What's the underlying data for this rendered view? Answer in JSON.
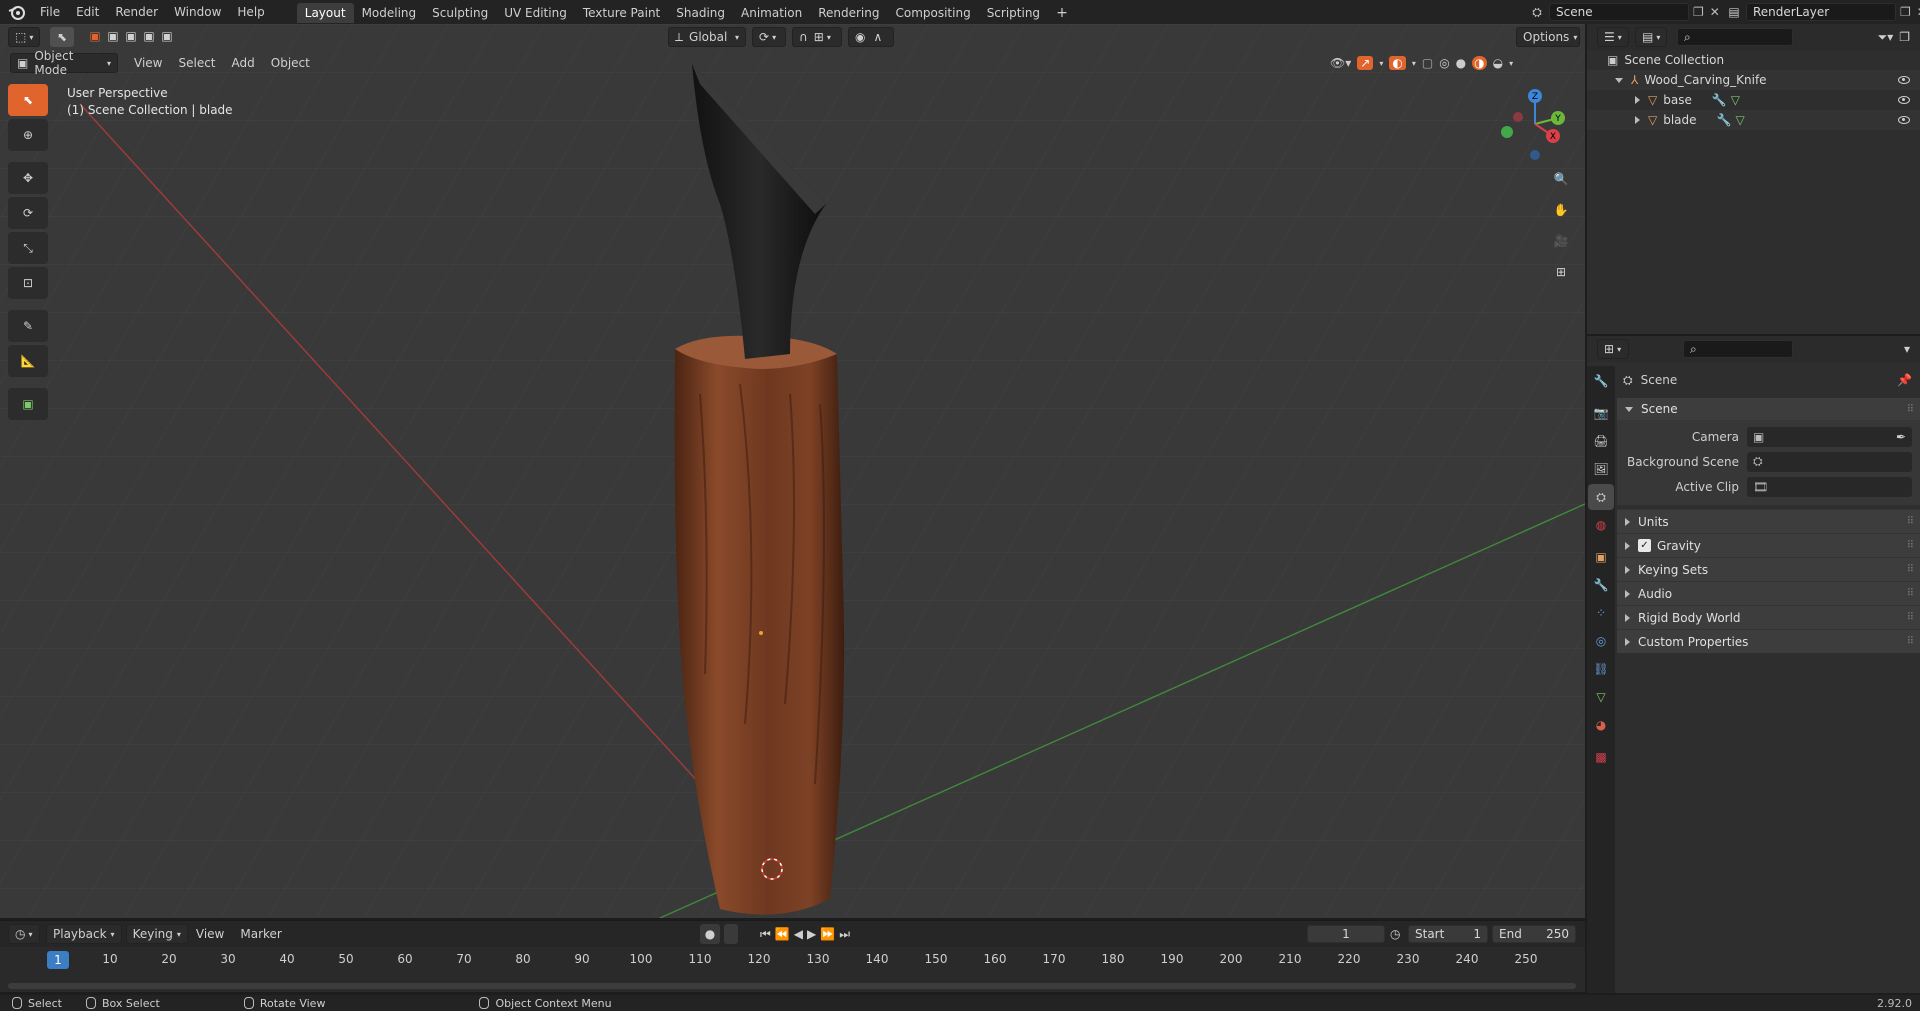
{
  "topbar": {
    "menus": [
      "File",
      "Edit",
      "Render",
      "Window",
      "Help"
    ],
    "workspaces": [
      "Layout",
      "Modeling",
      "Sculpting",
      "UV Editing",
      "Texture Paint",
      "Shading",
      "Animation",
      "Rendering",
      "Compositing",
      "Scripting"
    ],
    "active_workspace": "Layout",
    "add_tab_label": "+",
    "scene_name": "Scene",
    "view_layer": "RenderLayer"
  },
  "viewport": {
    "mode": "Object Mode",
    "menus": [
      "View",
      "Select",
      "Add",
      "Object"
    ],
    "transform_orientation": "Global",
    "options_label": "Options",
    "perspective_label": "User Perspective",
    "collection_label": "(1) Scene Collection | blade",
    "tools": [
      "select-box-icon",
      "cursor-icon",
      "move-icon",
      "rotate-icon",
      "scale-icon",
      "transform-icon",
      "annotate-icon",
      "measure-icon",
      "add-cube-icon"
    ],
    "gizmo_axes": [
      "X",
      "Y",
      "Z"
    ]
  },
  "timeline": {
    "menus": [
      "Playback",
      "Keying",
      "View",
      "Marker"
    ],
    "current_frame": "1",
    "start_label": "Start",
    "start_value": "1",
    "end_label": "End",
    "end_value": "250",
    "ruler_ticks": [
      "10",
      "20",
      "30",
      "40",
      "50",
      "60",
      "70",
      "80",
      "90",
      "100",
      "110",
      "120",
      "130",
      "140",
      "150",
      "160",
      "170",
      "180",
      "190",
      "200",
      "210",
      "220",
      "230",
      "240",
      "250"
    ],
    "frame_marker": "1"
  },
  "statusbar": {
    "items": [
      "Select",
      "Box Select",
      "Rotate View",
      "Object Context Menu"
    ],
    "version": "2.92.0"
  },
  "outliner": {
    "root": "Scene Collection",
    "collection": "Wood_Carving_Knife",
    "objects": [
      "base",
      "blade"
    ]
  },
  "properties": {
    "context_label": "Scene",
    "panel_title": "Scene",
    "fields": [
      {
        "label": "Camera",
        "value": ""
      },
      {
        "label": "Background Scene",
        "value": ""
      },
      {
        "label": "Active Clip",
        "value": ""
      }
    ],
    "subpanels": [
      "Units",
      "Gravity",
      "Keying Sets",
      "Audio",
      "Rigid Body World",
      "Custom Properties"
    ],
    "gravity_checked": true
  },
  "colors": {
    "accent": "#e0642c",
    "frame_blue": "#3b7ec4",
    "x_axis": "#d9404a",
    "y_axis": "#6cb83b",
    "z_axis": "#3d86d9"
  }
}
